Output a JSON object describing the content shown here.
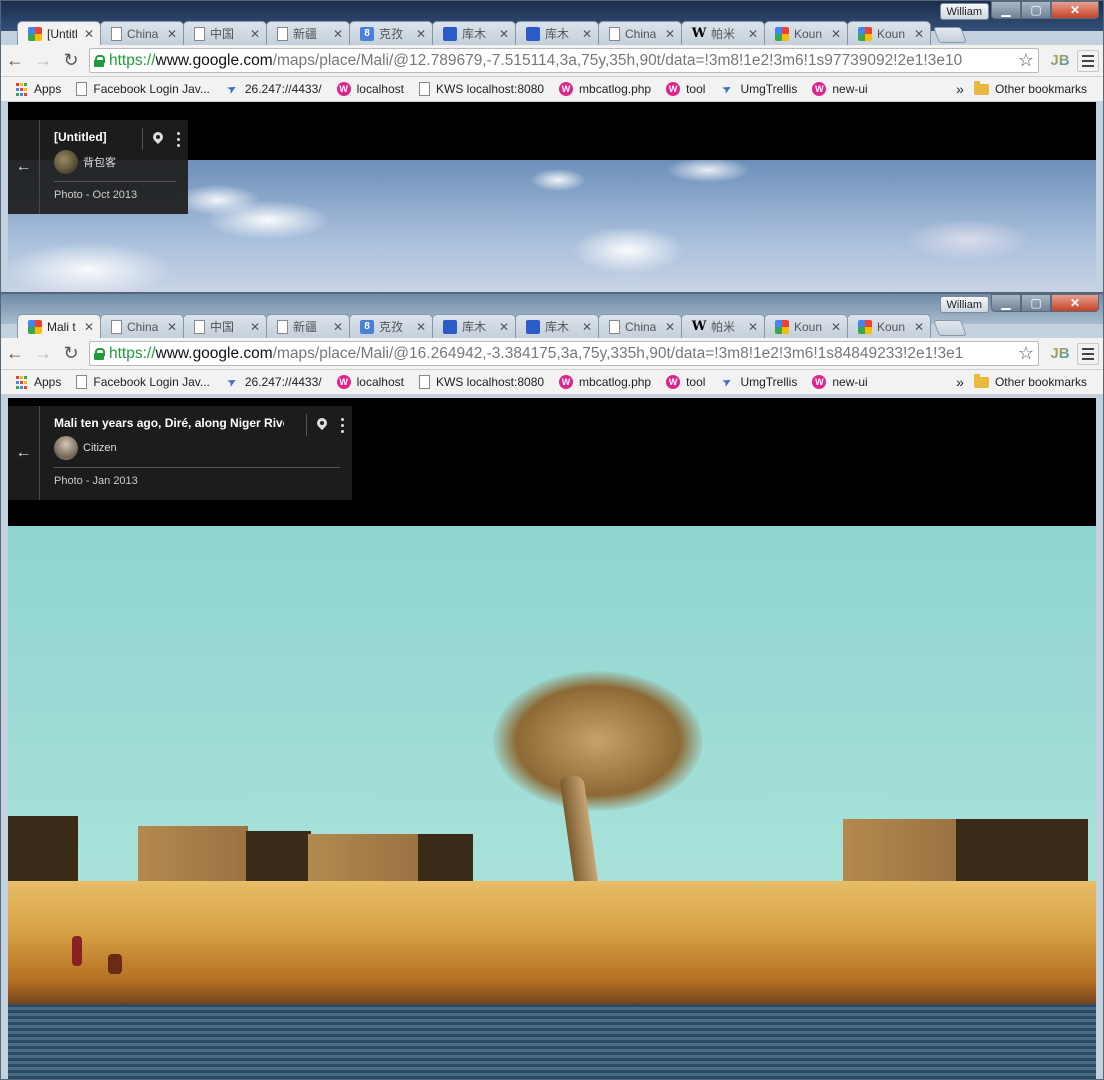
{
  "window1": {
    "user": "William",
    "tabs": [
      {
        "label": "[Untitl",
        "icon": "maps",
        "active": true
      },
      {
        "label": "China",
        "icon": "doc"
      },
      {
        "label": "中国",
        "icon": "doc"
      },
      {
        "label": "新疆",
        "icon": "doc"
      },
      {
        "label": "克孜",
        "icon": "g"
      },
      {
        "label": "库木",
        "icon": "paw"
      },
      {
        "label": "库木",
        "icon": "paw"
      },
      {
        "label": "China",
        "icon": "doc"
      },
      {
        "label": "帕米",
        "icon": "w"
      },
      {
        "label": "Koun",
        "icon": "maps"
      },
      {
        "label": "Koun",
        "icon": "maps"
      }
    ],
    "url": {
      "scheme": "https://",
      "host": "www.google.com",
      "path": "/maps/place/Mali/@12.789679,-7.515114,3a,75y,35h,90t/data=!3m8!1e2!3m6!1s97739092!2e1!3e10"
    },
    "card": {
      "title": "[Untitled]",
      "user": "背包客",
      "date": "Photo - Oct 2013"
    }
  },
  "window2": {
    "user": "William",
    "tabs": [
      {
        "label": "Mali t",
        "icon": "maps",
        "active": true
      },
      {
        "label": "China",
        "icon": "doc"
      },
      {
        "label": "中国",
        "icon": "doc"
      },
      {
        "label": "新疆",
        "icon": "doc"
      },
      {
        "label": "克孜",
        "icon": "g"
      },
      {
        "label": "库木",
        "icon": "paw"
      },
      {
        "label": "库木",
        "icon": "paw"
      },
      {
        "label": "China",
        "icon": "doc"
      },
      {
        "label": "帕米",
        "icon": "w"
      },
      {
        "label": "Koun",
        "icon": "maps"
      },
      {
        "label": "Koun",
        "icon": "maps"
      }
    ],
    "url": {
      "scheme": "https://",
      "host": "www.google.com",
      "path": "/maps/place/Mali/@16.264942,-3.384175,3a,75y,335h,90t/data=!3m8!1e2!3m6!1s84849233!2e1!3e1"
    },
    "card": {
      "title": "Mali ten years ago, Diré, along Niger River",
      "user": "Citizen",
      "date": "Photo - Jan 2013"
    }
  },
  "bookmarks": [
    {
      "label": "Apps",
      "icon": "apps"
    },
    {
      "label": "Facebook Login Jav...",
      "icon": "page"
    },
    {
      "label": "26.247://4433/",
      "icon": "link"
    },
    {
      "label": "localhost",
      "icon": "w"
    },
    {
      "label": "KWS localhost:8080",
      "icon": "page"
    },
    {
      "label": "mbcatlog.php",
      "icon": "w"
    },
    {
      "label": "tool",
      "icon": "w"
    },
    {
      "label": "UmgTrellis",
      "icon": "link"
    },
    {
      "label": "new-ui",
      "icon": "w"
    }
  ],
  "bookmarks_more": "»",
  "other_bookmarks": "Other bookmarks",
  "extension_label": "JB"
}
